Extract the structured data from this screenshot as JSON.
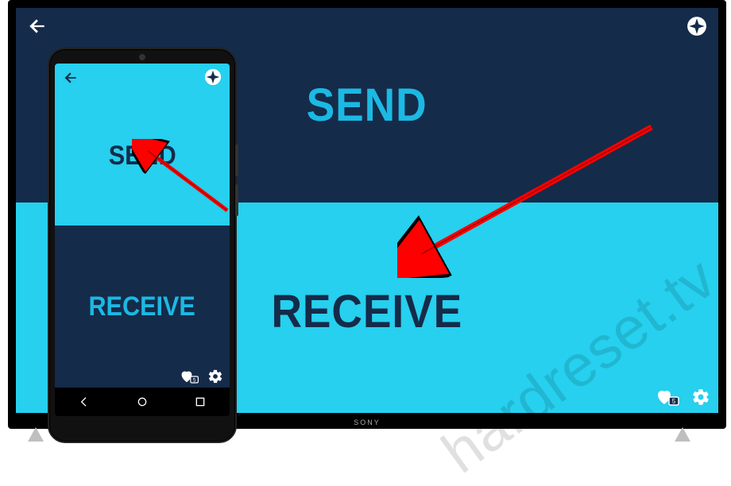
{
  "tv": {
    "send_label": "SEND",
    "receive_label": "RECEIVE",
    "brand": "SONY"
  },
  "phone": {
    "send_label": "SEND",
    "receive_label": "RECEIVE"
  },
  "icons": {
    "back": "back-arrow-icon",
    "compass": "compass-icon",
    "heart": "heart-badge-icon",
    "gear": "gear-icon",
    "nav_back": "nav-back-icon",
    "nav_home": "nav-home-icon",
    "nav_recent": "nav-recent-icon"
  },
  "colors": {
    "dark": "#152b4a",
    "cyan": "#26d0ee",
    "cyan_text": "#1bb9e3",
    "arrow": "#ff0000"
  },
  "watermark": "hardreset.tv"
}
